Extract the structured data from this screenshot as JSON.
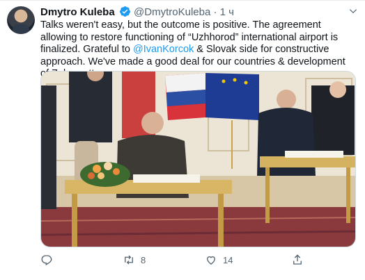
{
  "tweet": {
    "author_name": "Dmytro Kuleba",
    "author_handle": "@DmytroKuleba",
    "separator": "·",
    "time": "1 ч",
    "text_part1": "Talks weren't easy, but the outcome is positive. The agreement allowing to restore functioning of “Uzhhorod” international airport is finalized. Grateful to ",
    "mention": "@IvanKorcok",
    "text_part2": " & Slovak side for constructive approach. We've made a good deal for our countries & development of Zakarpattya."
  },
  "actions": {
    "reply_count": "",
    "retweet_count": "8",
    "like_count": "14"
  },
  "colors": {
    "accent": "#1d9bf0",
    "secondary_text": "#536471"
  },
  "icons": [
    "verified-badge-icon",
    "chevron-down-icon",
    "reply-icon",
    "retweet-icon",
    "like-icon",
    "share-icon"
  ]
}
